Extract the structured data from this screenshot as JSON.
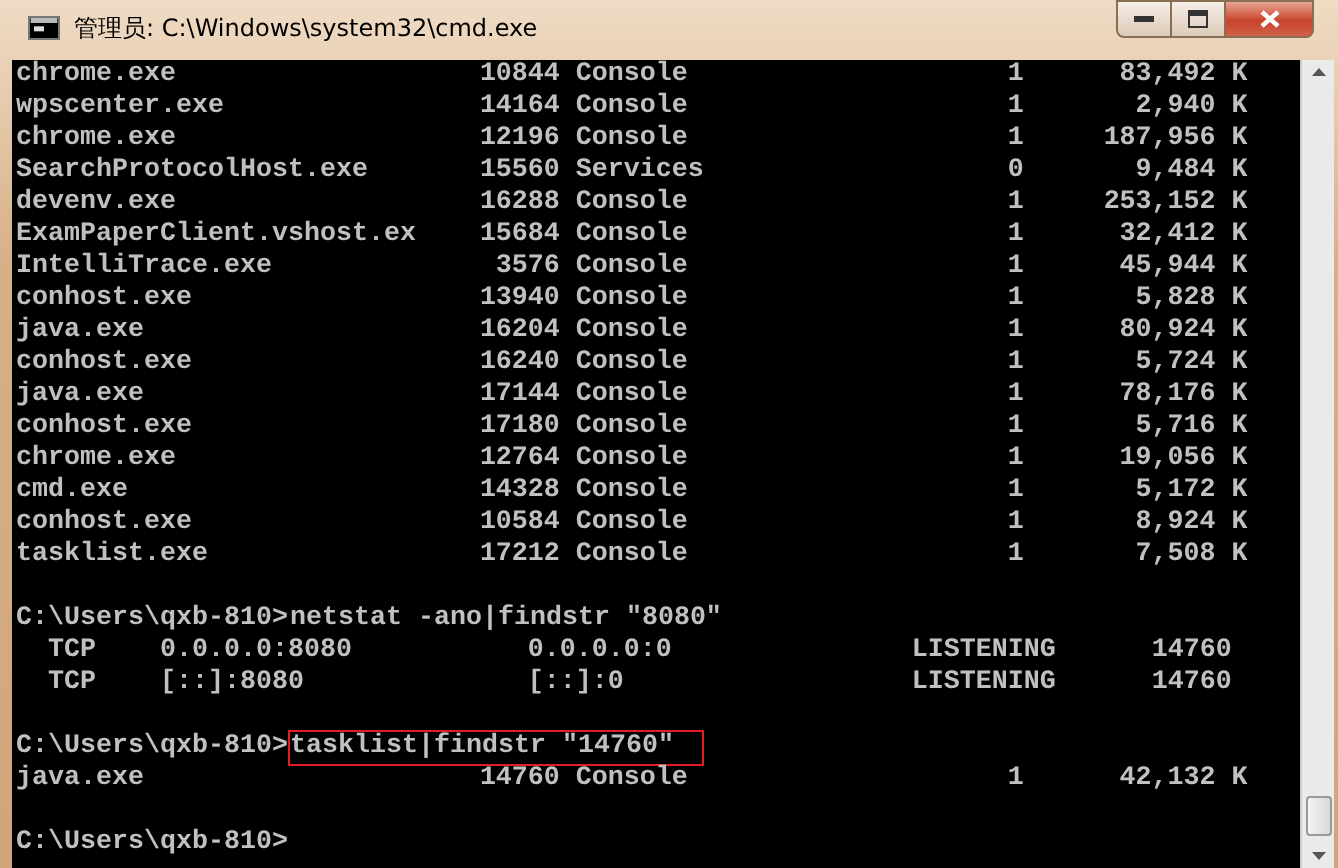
{
  "window": {
    "title": "管理员: C:\\Windows\\system32\\cmd.exe"
  },
  "console": {
    "lines": [
      {
        "kind": "process",
        "name": "chrome.exe",
        "pid": "10844",
        "session": "Console",
        "session_no": "1",
        "memory": "83,492 K"
      },
      {
        "kind": "process",
        "name": "wpscenter.exe",
        "pid": "14164",
        "session": "Console",
        "session_no": "1",
        "memory": "2,940 K"
      },
      {
        "kind": "process",
        "name": "chrome.exe",
        "pid": "12196",
        "session": "Console",
        "session_no": "1",
        "memory": "187,956 K"
      },
      {
        "kind": "process",
        "name": "SearchProtocolHost.exe",
        "pid": "15560",
        "session": "Services",
        "session_no": "0",
        "memory": "9,484 K"
      },
      {
        "kind": "process",
        "name": "devenv.exe",
        "pid": "16288",
        "session": "Console",
        "session_no": "1",
        "memory": "253,152 K"
      },
      {
        "kind": "process",
        "name": "ExamPaperClient.vshost.ex",
        "pid": "15684",
        "session": "Console",
        "session_no": "1",
        "memory": "32,412 K"
      },
      {
        "kind": "process",
        "name": "IntelliTrace.exe",
        "pid": "3576",
        "session": "Console",
        "session_no": "1",
        "memory": "45,944 K"
      },
      {
        "kind": "process",
        "name": "conhost.exe",
        "pid": "13940",
        "session": "Console",
        "session_no": "1",
        "memory": "5,828 K"
      },
      {
        "kind": "process",
        "name": "java.exe",
        "pid": "16204",
        "session": "Console",
        "session_no": "1",
        "memory": "80,924 K"
      },
      {
        "kind": "process",
        "name": "conhost.exe",
        "pid": "16240",
        "session": "Console",
        "session_no": "1",
        "memory": "5,724 K"
      },
      {
        "kind": "process",
        "name": "java.exe",
        "pid": "17144",
        "session": "Console",
        "session_no": "1",
        "memory": "78,176 K"
      },
      {
        "kind": "process",
        "name": "conhost.exe",
        "pid": "17180",
        "session": "Console",
        "session_no": "1",
        "memory": "5,716 K"
      },
      {
        "kind": "process",
        "name": "chrome.exe",
        "pid": "12764",
        "session": "Console",
        "session_no": "1",
        "memory": "19,056 K"
      },
      {
        "kind": "process",
        "name": "cmd.exe",
        "pid": "14328",
        "session": "Console",
        "session_no": "1",
        "memory": "5,172 K"
      },
      {
        "kind": "process",
        "name": "conhost.exe",
        "pid": "10584",
        "session": "Console",
        "session_no": "1",
        "memory": "8,924 K"
      },
      {
        "kind": "process",
        "name": "tasklist.exe",
        "pid": "17212",
        "session": "Console",
        "session_no": "1",
        "memory": "7,508 K"
      },
      {
        "kind": "blank"
      },
      {
        "kind": "prompt",
        "prompt": "C:\\Users\\qxb-810>",
        "command": "netstat -ano|findstr \"8080\"",
        "highlighted": false
      },
      {
        "kind": "netstat",
        "protocol": "TCP",
        "local": "0.0.0.0:8080",
        "foreign": "0.0.0.0:0",
        "state": "LISTENING",
        "pid": "14760"
      },
      {
        "kind": "netstat",
        "protocol": "TCP",
        "local": "[::]:8080",
        "foreign": "[::]:0",
        "state": "LISTENING",
        "pid": "14760"
      },
      {
        "kind": "blank"
      },
      {
        "kind": "prompt",
        "prompt": "C:\\Users\\qxb-810>",
        "command": "tasklist|findstr \"14760\"",
        "highlighted": true
      },
      {
        "kind": "process",
        "name": "java.exe",
        "pid": "14760",
        "session": "Console",
        "session_no": "1",
        "memory": "42,132 K"
      },
      {
        "kind": "blank"
      },
      {
        "kind": "prompt",
        "prompt": "C:\\Users\\qxb-810>"
      }
    ]
  }
}
